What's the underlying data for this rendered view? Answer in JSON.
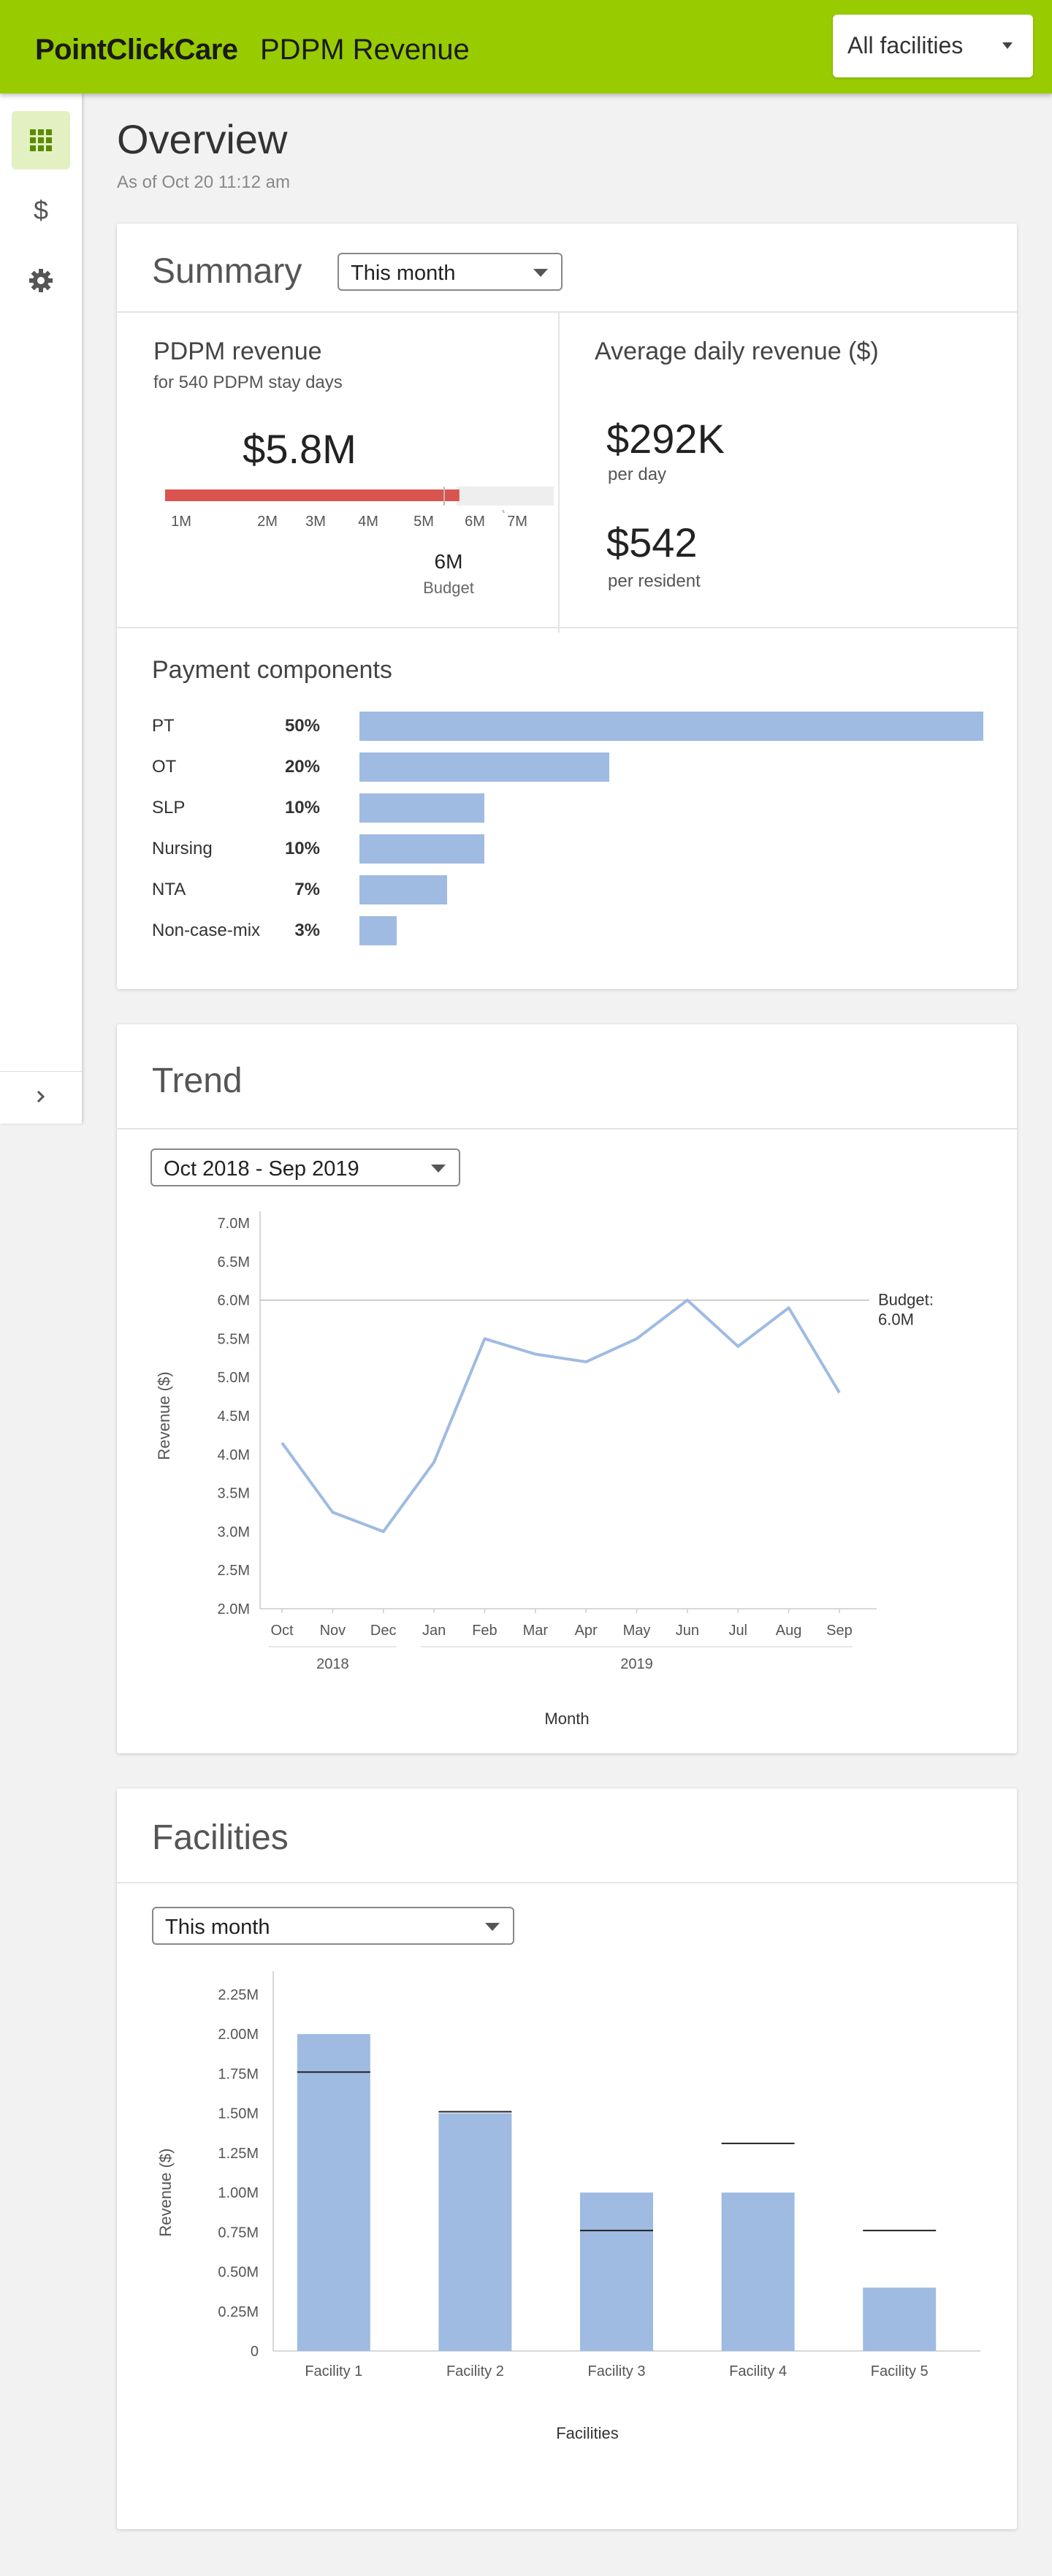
{
  "header": {
    "brand": "PointClickCare",
    "title": "PDPM Revenue",
    "facility_selector": "All facilities"
  },
  "sidebar": {
    "items": [
      {
        "name": "grid-icon",
        "active": true
      },
      {
        "name": "dollar-icon",
        "active": false
      },
      {
        "name": "gear-icon",
        "active": false
      }
    ],
    "expand_icon": "chevron-right-icon"
  },
  "overview": {
    "title": "Overview",
    "as_of": "As of Oct 20 11:12 am"
  },
  "summary": {
    "title": "Summary",
    "period": "This month",
    "pdpm": {
      "label": "PDPM revenue",
      "sub": "for 540 PDPM stay days",
      "value": "$5.8M",
      "value_m": 5.8,
      "budget_m": 6,
      "scale_ticks": [
        "1M",
        "2M",
        "3M",
        "4M",
        "5M",
        "6M",
        "7M"
      ],
      "budget_value": "6M",
      "budget_label": "Budget",
      "bar_color": "#d9534f"
    },
    "avg": {
      "label": "Average daily revenue ($)",
      "per_day_value": "$292K",
      "per_day_label": "per day",
      "per_resident_value": "$542",
      "per_resident_label": "per resident"
    },
    "payment": {
      "title": "Payment components",
      "items": [
        {
          "name": "PT",
          "pct": "50%",
          "value": 50
        },
        {
          "name": "OT",
          "pct": "20%",
          "value": 20
        },
        {
          "name": "SLP",
          "pct": "10%",
          "value": 10
        },
        {
          "name": "Nursing",
          "pct": "10%",
          "value": 10
        },
        {
          "name": "NTA",
          "pct": "7%",
          "value": 7
        },
        {
          "name": "Non-case-mix",
          "pct": "3%",
          "value": 3
        }
      ],
      "bar_color": "#9fbbe2"
    }
  },
  "trend": {
    "title": "Trend",
    "period": "Oct 2018 - Sep 2019"
  },
  "facilities": {
    "title": "Facilities",
    "period": "This month"
  },
  "chart_data": [
    {
      "type": "line",
      "x": [
        "Oct",
        "Nov",
        "Dec",
        "Jan",
        "Feb",
        "Mar",
        "Apr",
        "May",
        "Jun",
        "Jul",
        "Aug",
        "Sep"
      ],
      "x_groups": [
        {
          "label": "2018",
          "months": [
            "Oct",
            "Nov",
            "Dec"
          ]
        },
        {
          "label": "2019",
          "months": [
            "Jan",
            "Feb",
            "Mar",
            "Apr",
            "May",
            "Jun",
            "Jul",
            "Aug",
            "Sep"
          ]
        }
      ],
      "series": [
        {
          "values": [
            4.15,
            3.25,
            3.0,
            3.9,
            5.5,
            5.3,
            5.2,
            5.5,
            6.0,
            5.4,
            5.9,
            4.8
          ]
        }
      ],
      "xlabel": "Month",
      "ylabel": "Revenue ($)",
      "yticks": [
        "2.0M",
        "2.5M",
        "3.0M",
        "3.5M",
        "4.0M",
        "4.5M",
        "5.0M",
        "5.5M",
        "6.0M",
        "6.5M",
        "7.0M"
      ],
      "ylim": [
        2.0,
        7.0
      ],
      "reference_line": {
        "value": 6.0,
        "label_1": "Budget:",
        "label_2": "6.0M"
      },
      "color": "#9fbbe2"
    },
    {
      "type": "bar",
      "categories": [
        "Facility 1",
        "Facility 2",
        "Facility 3",
        "Facility 4",
        "Facility 5"
      ],
      "values": [
        2.0,
        1.5,
        1.0,
        1.0,
        0.4
      ],
      "budget": [
        1.76,
        1.51,
        0.76,
        1.31,
        0.76
      ],
      "xlabel": "Facilities",
      "ylabel": "Revenue ($)",
      "yticks": [
        "0",
        "0.25M",
        "0.50M",
        "0.75M",
        "1.00M",
        "1.25M",
        "1.50M",
        "1.75M",
        "2.00M",
        "2.25M"
      ],
      "ylim": [
        0,
        2.25
      ],
      "color": "#9fbbe2"
    }
  ]
}
